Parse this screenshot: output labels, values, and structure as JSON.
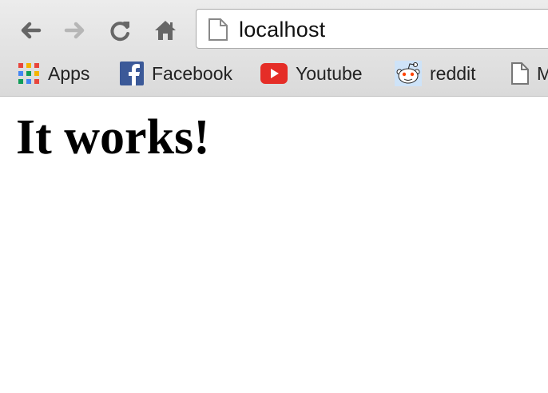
{
  "toolbar": {
    "url": "localhost"
  },
  "bookmarks": [
    {
      "label": "Apps",
      "icon": "apps-grid-icon"
    },
    {
      "label": "Facebook",
      "icon": "facebook-icon"
    },
    {
      "label": "Youtube",
      "icon": "youtube-icon"
    },
    {
      "label": "reddit",
      "icon": "reddit-icon"
    },
    {
      "label": "M",
      "icon": "page-icon"
    }
  ],
  "page": {
    "heading": "It works!"
  },
  "colors": {
    "facebook": "#3b5998",
    "youtube": "#e52d27",
    "reddit_eye": "#ff4500"
  }
}
